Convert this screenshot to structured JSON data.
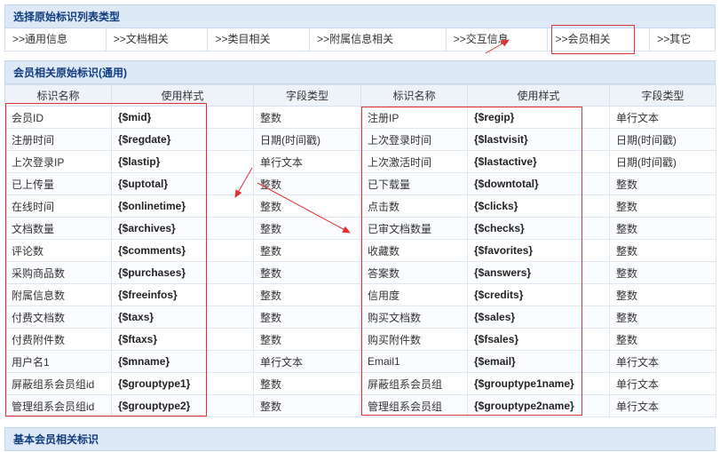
{
  "section1_title": "选择原始标识列表类型",
  "nav": [
    {
      "label": ">>通用信息"
    },
    {
      "label": ">>文档相关"
    },
    {
      "label": ">>类目相关"
    },
    {
      "label": ">>附属信息相关"
    },
    {
      "label": ">>交互信息"
    },
    {
      "label": ">>会员相关"
    },
    {
      "label": ">>其它"
    }
  ],
  "section2_title": "会员相关原始标识(通用)",
  "columns": {
    "name": "标识名称",
    "usage": "使用样式",
    "type": "字段类型",
    "name2": "标识名称",
    "usage2": "使用样式",
    "type2": "字段类型"
  },
  "rows": [
    [
      "会员ID",
      "{$mid}",
      "整数",
      "注册IP",
      "{$regip}",
      "单行文本"
    ],
    [
      "注册时间",
      "{$regdate}",
      "日期(时间戳)",
      "上次登录时间",
      "{$lastvisit}",
      "日期(时间戳)"
    ],
    [
      "上次登录IP",
      "{$lastip}",
      "单行文本",
      "上次激活时间",
      "{$lastactive}",
      "日期(时间戳)"
    ],
    [
      "已上传量",
      "{$uptotal}",
      "整数",
      "已下载量",
      "{$downtotal}",
      "整数"
    ],
    [
      "在线时间",
      "{$onlinetime}",
      "整数",
      "点击数",
      "{$clicks}",
      "整数"
    ],
    [
      "文档数量",
      "{$archives}",
      "整数",
      "已审文档数量",
      "{$checks}",
      "整数"
    ],
    [
      "评论数",
      "{$comments}",
      "整数",
      "收藏数",
      "{$favorites}",
      "整数"
    ],
    [
      "采购商品数",
      "{$purchases}",
      "整数",
      "答案数",
      "{$answers}",
      "整数"
    ],
    [
      "附属信息数",
      "{$freeinfos}",
      "整数",
      "信用度",
      "{$credits}",
      "整数"
    ],
    [
      "付费文档数",
      "{$taxs}",
      "整数",
      "购买文档数",
      "{$sales}",
      "整数"
    ],
    [
      "付费附件数",
      "{$ftaxs}",
      "整数",
      "购买附件数",
      "{$fsales}",
      "整数"
    ],
    [
      "用户名1",
      "{$mname}",
      "单行文本",
      "Email1",
      "{$email}",
      "单行文本"
    ],
    [
      "屏蔽组系会员组id",
      "{$grouptype1}",
      "整数",
      "屏蔽组系会员组",
      "{$grouptype1name}",
      "单行文本"
    ],
    [
      "管理组系会员组id",
      "{$grouptype2}",
      "整数",
      "管理组系会员组",
      "{$grouptype2name}",
      "单行文本"
    ]
  ],
  "section3_title": "基本会员相关标识",
  "colors": {
    "header_bg": "#dde9f7",
    "header_text": "#0f3c7c",
    "annotation_red": "#e13232"
  }
}
